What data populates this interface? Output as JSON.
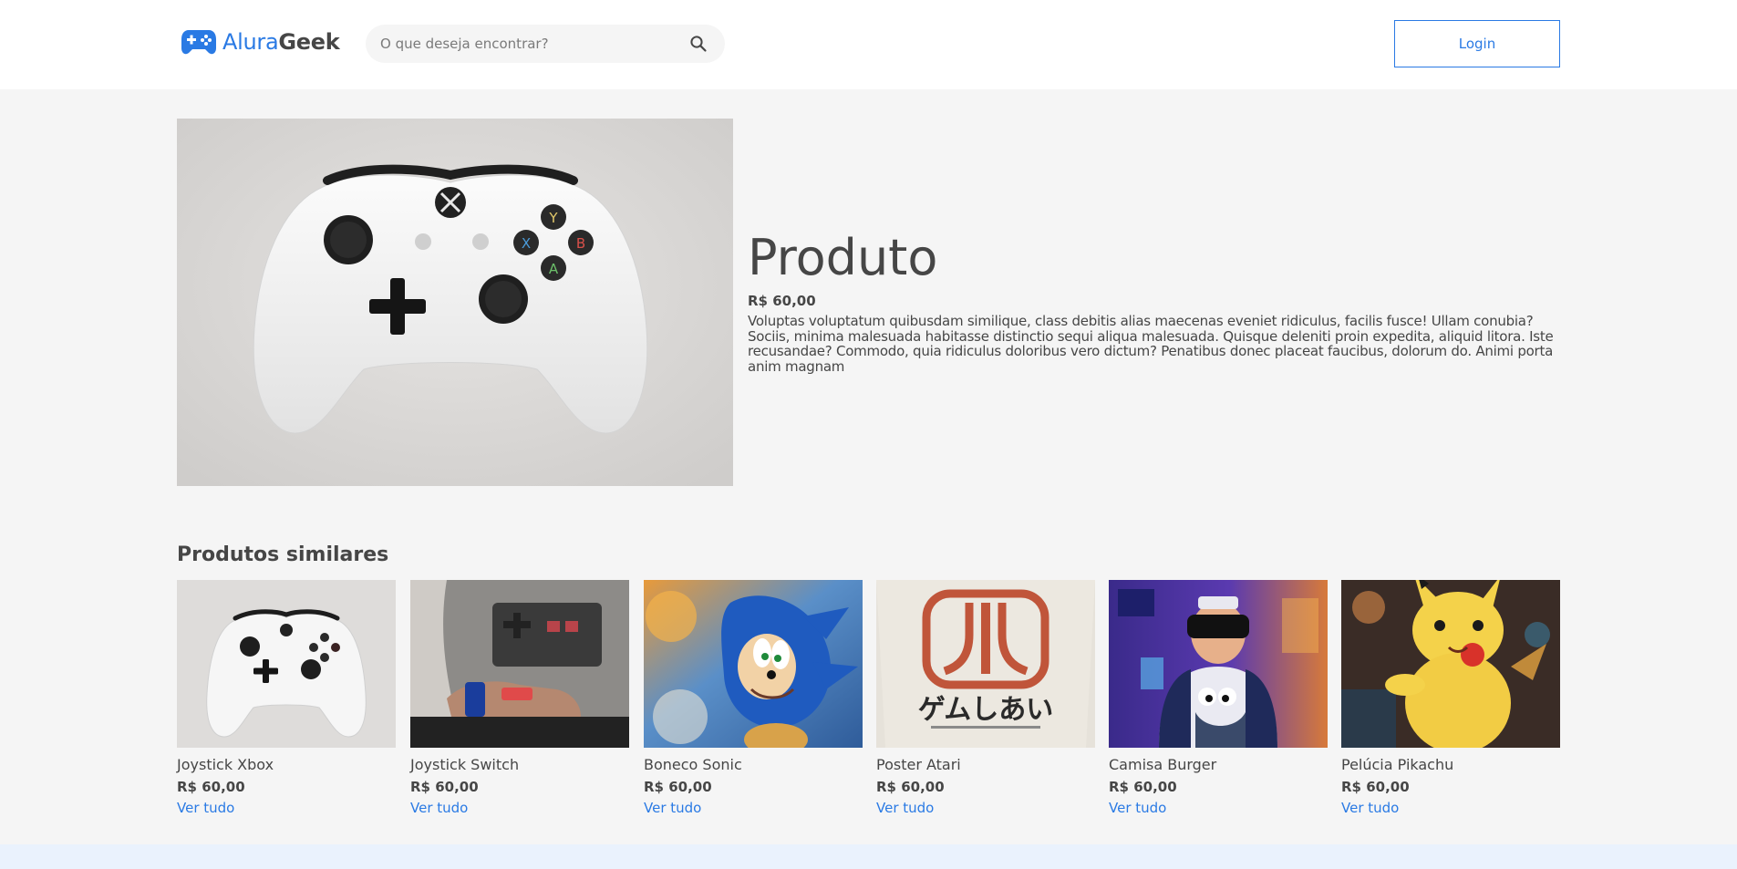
{
  "header": {
    "logo": {
      "part1": "Alura",
      "part2": "Geek",
      "icon": "gamepad-icon"
    },
    "search": {
      "placeholder": "O que deseja encontrar?",
      "icon": "search-icon"
    },
    "login_label": "Login"
  },
  "product": {
    "title": "Produto",
    "price": "R$ 60,00",
    "description": "Voluptas voluptatum quibusdam similique, class debitis alias maecenas eveniet ridiculus, facilis fusce! Ullam conubia? Sociis, minima malesuada habitasse distinctio sequi aliqua malesuada. Quisque deleniti proin expedita, aliquid litora. Iste recusandae? Commodo, quia ridiculus doloribus vero dictum? Penatibus donec placeat faucibus, dolorum do. Animi porta anim magnam"
  },
  "similar": {
    "title": "Produtos similares",
    "items": [
      {
        "name": "Joystick Xbox",
        "price": "R$ 60,00",
        "link": "Ver tudo"
      },
      {
        "name": "Joystick Switch",
        "price": "R$ 60,00",
        "link": "Ver tudo"
      },
      {
        "name": "Boneco Sonic",
        "price": "R$ 60,00",
        "link": "Ver tudo"
      },
      {
        "name": "Poster Atari",
        "price": "R$ 60,00",
        "link": "Ver tudo"
      },
      {
        "name": "Camisa Burger",
        "price": "R$ 60,00",
        "link": "Ver tudo"
      },
      {
        "name": "Pelúcia Pikachu",
        "price": "R$ 60,00",
        "link": "Ver tudo"
      }
    ]
  },
  "colors": {
    "brand": "#2a7ae4",
    "text": "#464646",
    "background": "#f5f5f5",
    "footer": "#eaf2fd"
  }
}
